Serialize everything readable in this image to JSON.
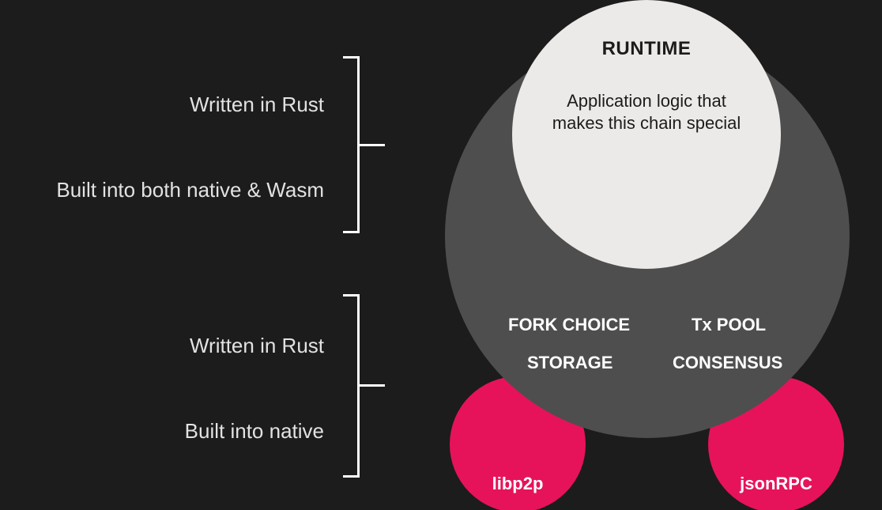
{
  "runtime": {
    "title": "RUNTIME",
    "description": "Application logic that makes this chain special"
  },
  "node_components": {
    "fork_choice": "FORK CHOICE",
    "tx_pool": "Tx POOL",
    "storage": "STORAGE",
    "consensus": "CONSENSUS"
  },
  "network_circles": {
    "left": "libp2p",
    "right": "jsonRPC"
  },
  "annotations": {
    "runtime_lang": "Written in Rust",
    "runtime_build": "Built into both native & Wasm",
    "node_lang": "Written in Rust",
    "node_build": "Built into native"
  },
  "colors": {
    "background": "#1c1c1c",
    "node_circle": "#4e4e4e",
    "runtime_circle": "#eceae8",
    "accent": "#e6135a",
    "text_light": "#ffffff"
  }
}
